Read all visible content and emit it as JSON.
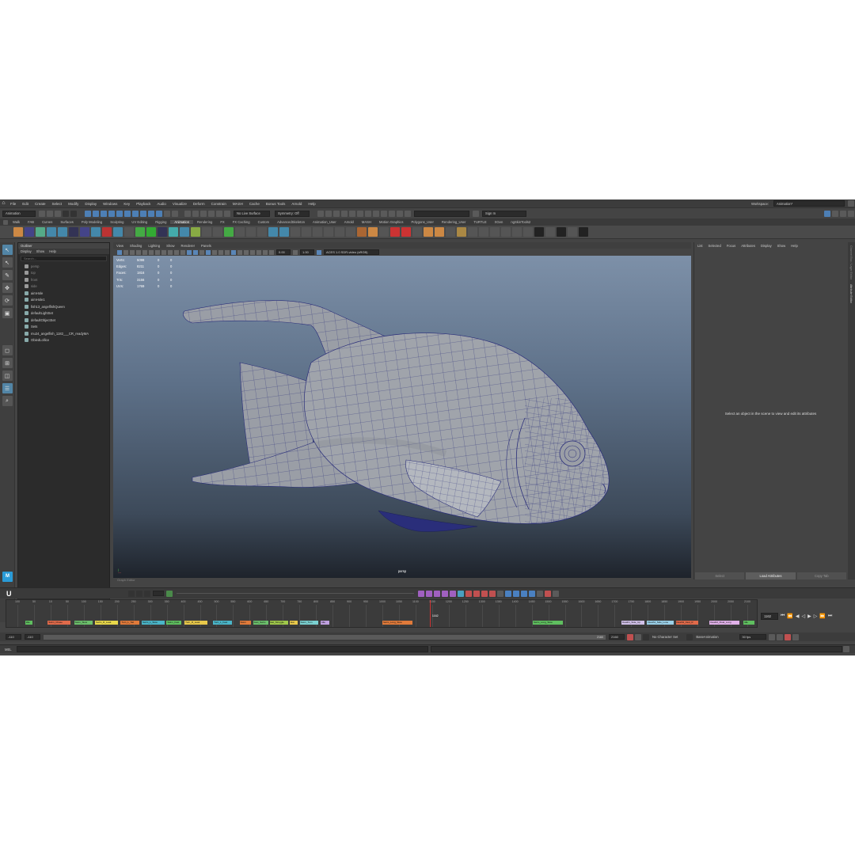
{
  "menubar": {
    "items": [
      "File",
      "Edit",
      "Create",
      "Select",
      "Modify",
      "Display",
      "Windows",
      "Key",
      "Playback",
      "Audio",
      "Visualize",
      "Deform",
      "Constrain",
      "MASH",
      "Cache",
      "Bonus Tools",
      "Arnold",
      "Help"
    ],
    "workspace_label": "Workspace:",
    "workspace_value": "Animation*"
  },
  "statusline": {
    "mode": "Animation",
    "live_surface": "No Live Surface",
    "symmetry": "Symmetry: Off",
    "sign_in": "Sign In"
  },
  "shelf": {
    "tabs": [
      "Curves",
      "Surfaces",
      "Poly Modeling",
      "Sculpting",
      "UV Editing",
      "Rigging",
      "Animation",
      "Rendering",
      "FX",
      "FX Caching",
      "Custom",
      "AdvancedSkeleton",
      "Animation_User",
      "Arnold",
      "MASH",
      "Motion Graphics",
      "Polygons_User",
      "Rendering_User",
      "TURTLE",
      "XGen",
      "ngSkinTools2"
    ],
    "first_tabs": [
      "Walk",
      "FAB"
    ],
    "active_tab": "Animation"
  },
  "outliner": {
    "title": "Outliner",
    "menus": [
      "Display",
      "Show",
      "Help"
    ],
    "search_placeholder": "Search...",
    "items": [
      {
        "label": "persp",
        "kind": "cam"
      },
      {
        "label": "top",
        "kind": "cam"
      },
      {
        "label": "front",
        "kind": "cam"
      },
      {
        "label": "side",
        "kind": "cam"
      },
      {
        "label": "aimHole",
        "kind": "obj"
      },
      {
        "label": "aimHole1",
        "kind": "obj"
      },
      {
        "label": "fish13_angelfishQueen",
        "kind": "obj"
      },
      {
        "label": "defaultLightSet",
        "kind": "set"
      },
      {
        "label": "defaultObjectSet",
        "kind": "set"
      },
      {
        "label": "Sets",
        "kind": "set"
      },
      {
        "label": "mu24_angelfish_1182___CR_readyMA",
        "kind": "obj"
      },
      {
        "label": "ObiedLollice",
        "kind": "obj"
      }
    ]
  },
  "viewport": {
    "menus": [
      "View",
      "Shading",
      "Lighting",
      "Show",
      "Renderer",
      "Panels"
    ],
    "exposure": "0.00",
    "gamma": "1.00",
    "colorspace": "ACES 1.0 SDR-video (sRGB)",
    "hud": [
      {
        "label": "Verts:",
        "v1": "5098",
        "v2": "0",
        "v3": "0"
      },
      {
        "label": "Edges:",
        "v1": "8211",
        "v2": "0",
        "v3": "0"
      },
      {
        "label": "Faces:",
        "v1": "1816",
        "v2": "0",
        "v3": "0"
      },
      {
        "label": "Tris:",
        "v1": "3156",
        "v2": "0",
        "v3": "0"
      },
      {
        "label": "UVs:",
        "v1": "1769",
        "v2": "0",
        "v3": "0"
      }
    ],
    "camera": "persp",
    "graph_label": "Graph Editor"
  },
  "attribute_editor": {
    "menus": [
      "List",
      "Selected",
      "Focus",
      "Attributes",
      "Display",
      "Show",
      "Help"
    ],
    "message": "Select an object in the scene to view and edit its attributes",
    "buttons": [
      "Select",
      "Load Attributes",
      "Copy Tab"
    ]
  },
  "side_tabs": [
    "Channel Box / Layer Editor",
    "Attribute Editor"
  ],
  "timeline": {
    "ticks": [
      "100",
      "50",
      "10",
      "50",
      "100",
      "150",
      "200",
      "250",
      "300",
      "350",
      "400",
      "450",
      "500",
      "550",
      "600",
      "650",
      "700",
      "750",
      "800",
      "850",
      "900",
      "950",
      "1000",
      "1050",
      "1100",
      "1150",
      "1200",
      "1250",
      "1300",
      "1350",
      "1400",
      "1450",
      "1500",
      "1550",
      "1600",
      "1650",
      "1700",
      "1750",
      "1800",
      "1850",
      "1900",
      "1950",
      "2000",
      "2050",
      "2100"
    ],
    "current_frame": "1162",
    "playhead_label": "1162",
    "clips": [
      {
        "label": "Idle",
        "color": "#5fbf5f",
        "start": 0.025,
        "width": 0.01
      },
      {
        "label": "Swim_Chase",
        "color": "#e06a4a",
        "start": 0.055,
        "width": 0.03
      },
      {
        "label": "Swim_Slow",
        "color": "#6bbf6b",
        "start": 0.09,
        "width": 0.025
      },
      {
        "label": "Swim_R_Leak",
        "color": "#e8d84a",
        "start": 0.118,
        "width": 0.03
      },
      {
        "label": "Turn_L_Tail",
        "color": "#e07a3a",
        "start": 0.152,
        "width": 0.025
      },
      {
        "label": "Swim_L_Slow",
        "color": "#4ab5c8",
        "start": 0.18,
        "width": 0.03
      },
      {
        "label": "Swim_Fast",
        "color": "#5fbf5f",
        "start": 0.213,
        "width": 0.02
      },
      {
        "label": "Turn_R_Leak",
        "color": "#e8c84a",
        "start": 0.237,
        "width": 0.03
      },
      {
        "label": "Turn_L_Fast",
        "color": "#4ab5c8",
        "start": 0.275,
        "width": 0.025
      },
      {
        "label": "Swim",
        "color": "#e07a3a",
        "start": 0.31,
        "width": 0.015
      },
      {
        "label": "Fast_Swim",
        "color": "#6bbf6b",
        "start": 0.328,
        "width": 0.02
      },
      {
        "label": "Eat_Struggle",
        "color": "#a0c84a",
        "start": 0.35,
        "width": 0.025
      },
      {
        "label": "Eat",
        "color": "#e8c84a",
        "start": 0.377,
        "width": 0.01
      },
      {
        "label": "Swim_Turn",
        "color": "#7ad0d0",
        "start": 0.39,
        "width": 0.025
      },
      {
        "label": "Idle",
        "color": "#c0a0e0",
        "start": 0.418,
        "width": 0.012
      },
      {
        "label": "Swim_Long_Slow",
        "color": "#e07a3a",
        "start": 0.5,
        "width": 0.04
      },
      {
        "label": "Swim_Long_Slow",
        "color": "#5fbf5f",
        "start": 0.7,
        "width": 0.04
      },
      {
        "label": "Death1_Side_Up",
        "color": "#d0c0e8",
        "start": 0.818,
        "width": 0.03
      },
      {
        "label": "Death1_Side_Lone",
        "color": "#9ad0e8",
        "start": 0.852,
        "width": 0.035
      },
      {
        "label": "Death2_Fast_R",
        "color": "#e06a4a",
        "start": 0.89,
        "width": 0.03
      },
      {
        "label": "Death2_Float_Long",
        "color": "#e0b0e8",
        "start": 0.935,
        "width": 0.04
      },
      {
        "label": "Idle",
        "color": "#5fbf5f",
        "start": 0.98,
        "width": 0.015
      }
    ],
    "range_start": "-110",
    "range_inner_start": "-110",
    "range_inner_end": "2160",
    "range_end": "2160",
    "character_set": "No Character Set",
    "anim_layer": "BaseAnimation",
    "fps": "30 fps"
  },
  "mel": {
    "label": "MEL"
  },
  "colors": {
    "accent": "#4d7fb5",
    "wire": "#2a2e7a",
    "mesh": "#9a9ea6"
  }
}
